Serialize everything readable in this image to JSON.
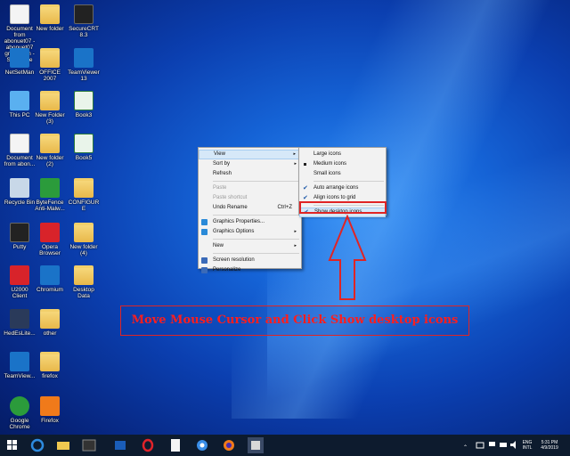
{
  "desktop": {
    "icons": [
      {
        "label": "Document from abonuet07 - abonuet07 gmail.com - SimpleMe",
        "type": "doc"
      },
      {
        "label": "New folder",
        "type": "folder"
      },
      {
        "label": "SecureCRT 8.3",
        "type": "app"
      },
      {
        "label": "NetSetMan",
        "type": "app"
      },
      {
        "label": "OFFICE 2007",
        "type": "folder"
      },
      {
        "label": "TeamViewer 13",
        "type": "app"
      },
      {
        "label": "This PC",
        "type": "app"
      },
      {
        "label": "New Folder (3)",
        "type": "folder"
      },
      {
        "label": "Book3",
        "type": "doc"
      },
      {
        "label": "Document from abon...",
        "type": "doc"
      },
      {
        "label": "New folder (2)",
        "type": "folder"
      },
      {
        "label": "Book5",
        "type": "doc"
      },
      {
        "label": "Recycle Bin",
        "type": "app"
      },
      {
        "label": "ByteFence Anti-Malw...",
        "type": "app"
      },
      {
        "label": "CONFIGURE",
        "type": "folder"
      },
      {
        "label": "Putty",
        "type": "app"
      },
      {
        "label": "Opera Browser",
        "type": "app"
      },
      {
        "label": "New folder (4)",
        "type": "folder"
      },
      {
        "label": "U2000 Client",
        "type": "app"
      },
      {
        "label": "Chromium",
        "type": "app"
      },
      {
        "label": "Desktop Data",
        "type": "folder"
      },
      {
        "label": "HedEsLite...",
        "type": "app"
      },
      {
        "label": "other",
        "type": "folder"
      },
      {
        "label": "TeamView...",
        "type": "app"
      },
      {
        "label": "firefox",
        "type": "folder"
      },
      {
        "label": "Google Chrome",
        "type": "app"
      },
      {
        "label": "Firefox",
        "type": "app"
      }
    ]
  },
  "context_menu": {
    "items": [
      {
        "label": "View",
        "arrow": "▸"
      },
      {
        "label": "Sort by",
        "arrow": "▸"
      },
      {
        "label": "Refresh"
      },
      {
        "label": "Paste"
      },
      {
        "label": "Paste shortcut"
      },
      {
        "label": "Undo Rename",
        "shortcut": "Ctrl+Z"
      },
      {
        "label": "Graphics Properties..."
      },
      {
        "label": "Graphics Options",
        "arrow": "▸"
      },
      {
        "label": "New",
        "arrow": "▸"
      },
      {
        "label": "Screen resolution"
      },
      {
        "label": "Personalize"
      }
    ]
  },
  "view_submenu": {
    "items": [
      {
        "label": "Large icons"
      },
      {
        "label": "Medium icons"
      },
      {
        "label": "Small icons"
      },
      {
        "label": "Auto arrange icons"
      },
      {
        "label": "Align icons to grid"
      },
      {
        "label": "Show desktop icons"
      }
    ],
    "check_glyph": "✔"
  },
  "annotation": {
    "instruction": "Move Mouse Cursor and Click Show desktop icons",
    "color": "#e02424"
  },
  "taskbar": {
    "language_top": "ENG",
    "language_bottom": "INTL",
    "time": "5:31 PM",
    "date": "4/9/2019"
  }
}
